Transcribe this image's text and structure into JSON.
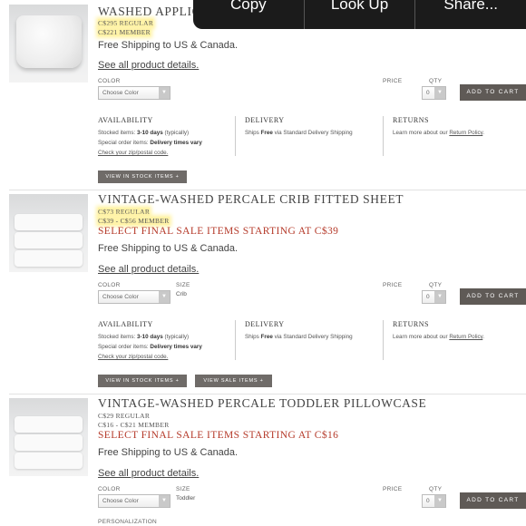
{
  "context_menu": {
    "items": [
      "Copy",
      "Look Up",
      "Share..."
    ]
  },
  "products": [
    {
      "title": "WASHED APPLIQUÉ",
      "price_regular": "C$295 REGULAR",
      "price_member": "C$221 MEMBER",
      "shipping": "Free Shipping to US & Canada.",
      "details_link": "See all product details.",
      "color_label": "COLOR",
      "color_value": "Choose Color",
      "price_label": "PRICE",
      "qty_label": "QTY",
      "qty_value": "0",
      "add_to_cart": "ADD TO CART",
      "availability": {
        "heading": "AVAILABILITY",
        "stocked_prefix": "Stocked items: ",
        "stocked_days": "3-10 days",
        "stocked_suffix": " (typically)",
        "special_prefix": "Special order items: ",
        "special_value": "Delivery times vary",
        "zip_link": "Check your zip/postal code."
      },
      "delivery": {
        "heading": "DELIVERY",
        "prefix": "Ships ",
        "bold": "Free",
        "suffix": " via Standard Delivery Shipping"
      },
      "returns": {
        "heading": "RETURNS",
        "prefix": "Learn more about our ",
        "link": "Return Policy",
        "suffix": "."
      },
      "buttons": [
        "VIEW IN STOCK ITEMS +"
      ]
    },
    {
      "title": "VINTAGE-WASHED PERCALE CRIB FITTED SHEET",
      "price_regular": "C$73 REGULAR",
      "price_member": "C$39 - C$56 MEMBER",
      "sale": "SELECT FINAL SALE ITEMS STARTING AT C$39",
      "shipping": "Free Shipping to US & Canada.",
      "details_link": "See all product details.",
      "color_label": "COLOR",
      "color_value": "Choose Color",
      "size_label": "SIZE",
      "size_value": "Crib",
      "price_label": "PRICE",
      "qty_label": "QTY",
      "qty_value": "0",
      "add_to_cart": "ADD TO CART",
      "availability": {
        "heading": "AVAILABILITY",
        "stocked_prefix": "Stocked items: ",
        "stocked_days": "3-10 days",
        "stocked_suffix": " (typically)",
        "special_prefix": "Special order items: ",
        "special_value": "Delivery times vary",
        "zip_link": "Check your zip/postal code."
      },
      "delivery": {
        "heading": "DELIVERY",
        "prefix": "Ships ",
        "bold": "Free",
        "suffix": " via Standard Delivery Shipping"
      },
      "returns": {
        "heading": "RETURNS",
        "prefix": "Learn more about our ",
        "link": "Return Policy",
        "suffix": "."
      },
      "buttons": [
        "VIEW IN STOCK ITEMS +",
        "VIEW SALE ITEMS +"
      ]
    },
    {
      "title": "VINTAGE-WASHED PERCALE TODDLER PILLOWCASE",
      "price_regular": "C$29 REGULAR",
      "price_member": "C$16 - C$21 MEMBER",
      "sale": "SELECT FINAL SALE ITEMS STARTING AT C$16",
      "shipping": "Free Shipping to US & Canada.",
      "details_link": "See all product details.",
      "color_label": "COLOR",
      "color_value": "Choose Color",
      "size_label": "SIZE",
      "size_value": "Toddler",
      "price_label": "PRICE",
      "qty_label": "QTY",
      "qty_value": "0",
      "add_to_cart": "ADD TO CART",
      "personalization_label": "PERSONALIZATION"
    }
  ]
}
